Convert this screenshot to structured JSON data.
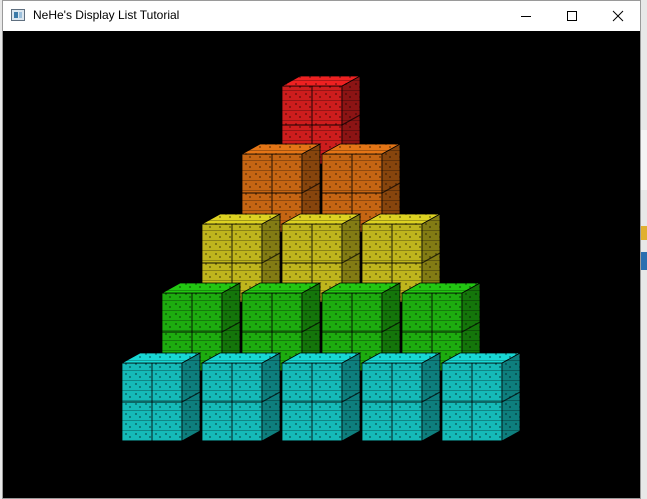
{
  "window": {
    "title": "NeHe's Display List Tutorial",
    "icons": {
      "app": "application-window-icon",
      "minimize": "minimize-icon",
      "maximize": "maximize-icon",
      "close": "close-icon"
    }
  },
  "scene": {
    "background": "#000000",
    "rows": [
      {
        "name": "top",
        "color": "#d81e1e",
        "cubes": 1
      },
      {
        "name": "second",
        "color": "#cf6a14",
        "cubes": 2
      },
      {
        "name": "middle",
        "color": "#c9bf1f",
        "cubes": 3
      },
      {
        "name": "fourth",
        "color": "#1fb510",
        "cubes": 4
      },
      {
        "name": "bottom",
        "color": "#16c4c2",
        "cubes": 5
      }
    ]
  }
}
